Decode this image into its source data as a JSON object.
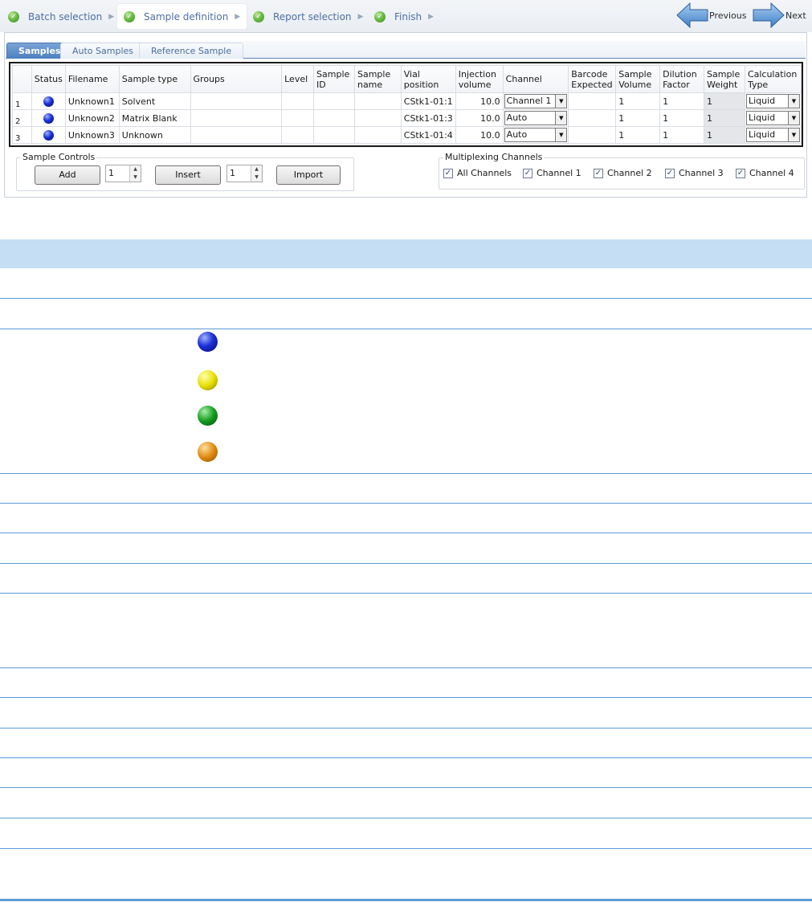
{
  "wizard": {
    "steps": [
      {
        "label": "Batch selection"
      },
      {
        "label": "Sample definition"
      },
      {
        "label": "Report selection"
      },
      {
        "label": "Finish"
      }
    ],
    "previous_label": "Previous",
    "next_label": "Next"
  },
  "tabs": [
    "Samples",
    "Auto Samples",
    "Reference Sample"
  ],
  "grid": {
    "columns": [
      "Status",
      "Filename",
      "Sample type",
      "Groups",
      "Level",
      "Sample ID",
      "Sample name",
      "Vial position",
      "Injection volume",
      "Channel",
      "Barcode Expected",
      "Sample Volume",
      "Dilution Factor",
      "Sample Weight",
      "Calculation Type"
    ],
    "rows": [
      {
        "num": "1",
        "filename": "Unknown1",
        "sample_type": "Solvent",
        "vial": "CStk1-01:1",
        "injection": "10.0",
        "channel": "Channel 1",
        "volume": "1",
        "dilution": "1",
        "weight": "1",
        "calc": "Liquid"
      },
      {
        "num": "2",
        "filename": "Unknown2",
        "sample_type": "Matrix Blank",
        "vial": "CStk1-01:3",
        "injection": "10.0",
        "channel": "Auto",
        "volume": "1",
        "dilution": "1",
        "weight": "1",
        "calc": "Liquid"
      },
      {
        "num": "3",
        "filename": "Unknown3",
        "sample_type": "Unknown",
        "vial": "CStk1-01:4",
        "injection": "10.0",
        "channel": "Auto",
        "volume": "1",
        "dilution": "1",
        "weight": "1",
        "calc": "Liquid"
      }
    ]
  },
  "controls": {
    "legend": "Sample Controls",
    "add_label": "Add",
    "add_count": "1",
    "insert_label": "Insert",
    "insert_count": "1",
    "import_label": "Import"
  },
  "multiplexing": {
    "legend": "Multiplexing Channels",
    "options": [
      "All Channels",
      "Channel 1",
      "Channel 2",
      "Channel 3",
      "Channel 4"
    ]
  },
  "colors": {
    "status_blue": "#1a2fd6",
    "status_yellow": "#e8e000",
    "status_green": "#139b1f",
    "status_orange": "#e08a10",
    "header_fill": "#c5def3",
    "rule": "#5b9bd5"
  }
}
